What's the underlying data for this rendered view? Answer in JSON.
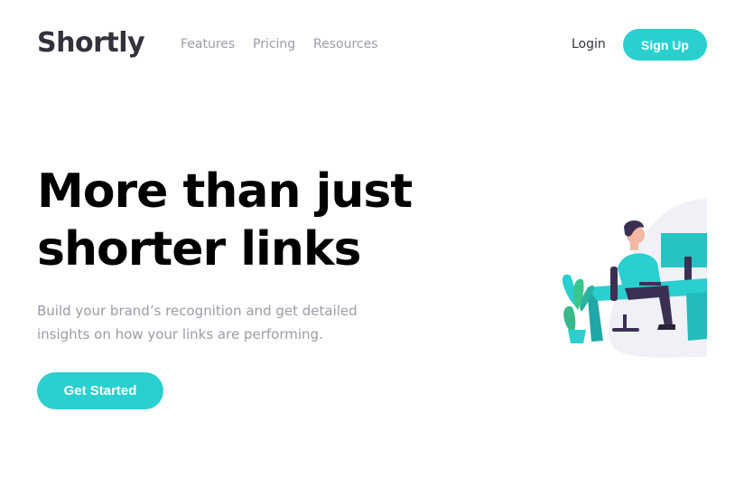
{
  "header": {
    "logo": "Shortly",
    "nav": [
      "Features",
      "Pricing",
      "Resources"
    ],
    "login": "Login",
    "signup": "Sign Up"
  },
  "hero": {
    "title_line1": "More than just",
    "title_line2": "shorter links",
    "subtitle_line1": "Build your brand’s recognition and get detailed",
    "subtitle_line2": "insights on how your links are performing.",
    "cta": "Get Started",
    "illustration": "person-working-at-desk"
  },
  "colors": {
    "primary": "#2acfcf",
    "dark": "#34313d",
    "gray": "#9e9aa7"
  }
}
